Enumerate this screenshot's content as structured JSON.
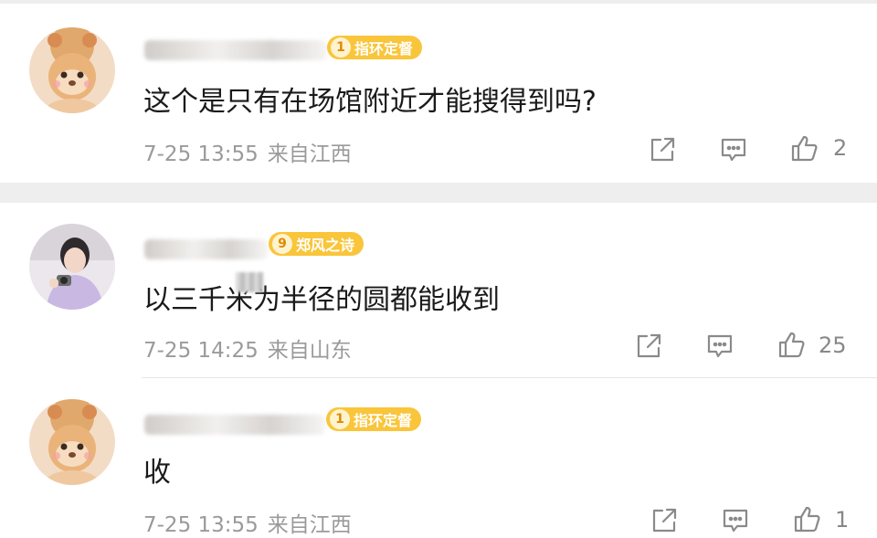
{
  "comments": [
    {
      "badge_level": "1",
      "badge_label": "指环定督",
      "text": "这个是只有在场馆附近才能搜得到吗?",
      "date": "7-25 13:55",
      "location": "来自江西",
      "likes": "2"
    },
    {
      "badge_level": "9",
      "badge_label": "郑风之诗",
      "text": "以三千米为半径的圆都能收到",
      "date": "7-25 14:25",
      "location": "来自山东",
      "likes": "25"
    },
    {
      "badge_level": "1",
      "badge_label": "指环定督",
      "text": "收",
      "date": "7-25 13:55",
      "location": "来自江西",
      "likes": "1"
    }
  ],
  "colors": {
    "badge": "#f9c53a",
    "meta_text": "#9a9a9a",
    "divider": "#eeeeee"
  }
}
